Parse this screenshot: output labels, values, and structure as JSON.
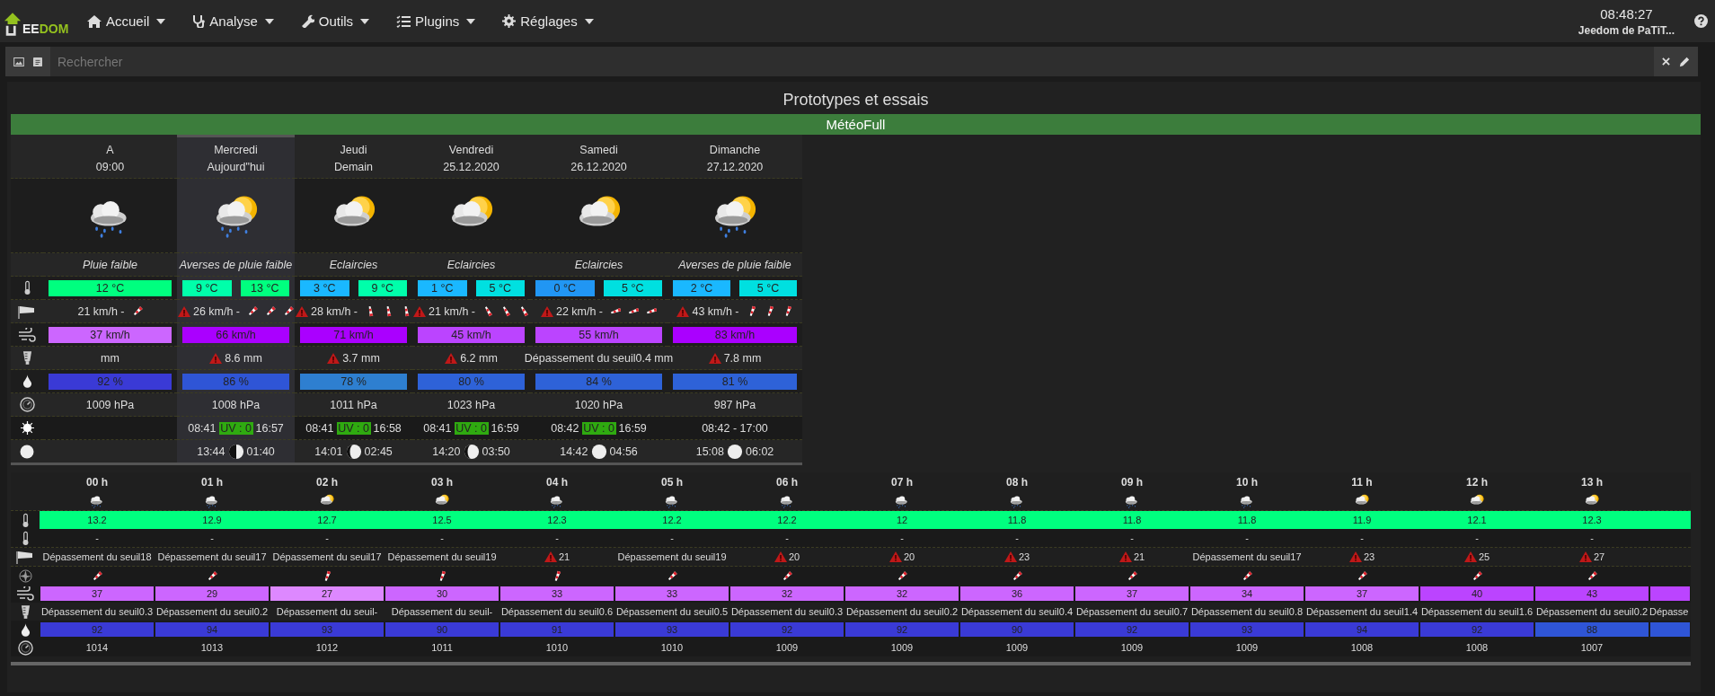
{
  "navbar": {
    "logo": {
      "text_light": "EE",
      "text_accent": "DOM"
    },
    "menu": [
      {
        "label": "Accueil"
      },
      {
        "label": "Analyse"
      },
      {
        "label": "Outils"
      },
      {
        "label": "Plugins"
      },
      {
        "label": "Réglages"
      }
    ],
    "time": "08:48:27",
    "user": "Jeedom de PaTiT..."
  },
  "search": {
    "placeholder": "Rechercher"
  },
  "view": {
    "title": "Prototypes et essais",
    "widget_title": "MétéoFull"
  },
  "daily": {
    "columns": [
      {
        "day": "A",
        "date": "09:00",
        "selected": false,
        "weather": {
          "kind": "rain"
        },
        "condition": "Pluie faible",
        "temps": [
          {
            "text": "12 °C",
            "color": "#00ff7f"
          }
        ],
        "wind": {
          "alert": false,
          "text": "21 km/h -",
          "directions": [
            {
              "kind": "ne"
            }
          ]
        },
        "gust": {
          "text": "37 km/h",
          "color": "#cc66ff"
        },
        "rain": {
          "alert": false,
          "text": "mm"
        },
        "humidity": {
          "text": "92 %",
          "color": "#3a3ad6"
        },
        "pressure": "1009 hPa",
        "sun": {
          "kind": "none"
        },
        "moon": {
          "kind": "none"
        }
      },
      {
        "day": "Mercredi",
        "date": "Aujourd\"hui",
        "selected": true,
        "weather": {
          "kind": "showers"
        },
        "condition": "Averses de pluie faible",
        "temps": [
          {
            "text": "9 °C",
            "color": "#00ffaa"
          },
          {
            "text": "13 °C",
            "color": "#00ff7f"
          }
        ],
        "wind": {
          "alert": true,
          "text": "26 km/h -",
          "directions": [
            {
              "kind": "ne"
            },
            {
              "kind": "ne"
            },
            {
              "kind": "ne"
            }
          ]
        },
        "gust": {
          "text": "66 km/h",
          "color": "#aa00ff"
        },
        "rain": {
          "alert": true,
          "text": "8.6 mm"
        },
        "humidity": {
          "text": "86 %",
          "color": "#2f55d6"
        },
        "pressure": "1008 hPa",
        "sun": {
          "kind": "uv",
          "rise": "08:41",
          "uv": "UV : 0",
          "set": "16:57"
        },
        "moon": {
          "kind": "times",
          "rise": "13:44",
          "icon": {
            "kind": "half"
          },
          "set": "01:40"
        }
      },
      {
        "day": "Jeudi",
        "date": "Demain",
        "selected": false,
        "weather": {
          "kind": "partly"
        },
        "condition": "Eclaircies",
        "temps": [
          {
            "text": "3 °C",
            "color": "#1ab8ff"
          },
          {
            "text": "9 °C",
            "color": "#00ffaa"
          }
        ],
        "wind": {
          "alert": true,
          "text": "28 km/h -",
          "directions": [
            {
              "kind": "s"
            },
            {
              "kind": "s"
            },
            {
              "kind": "s"
            }
          ]
        },
        "gust": {
          "text": "71 km/h",
          "color": "#aa00ff"
        },
        "rain": {
          "alert": true,
          "text": "3.7 mm"
        },
        "humidity": {
          "text": "78 %",
          "color": "#2e7fd0"
        },
        "pressure": "1011 hPa",
        "sun": {
          "kind": "uv",
          "rise": "08:41",
          "uv": "UV : 0",
          "set": "16:58"
        },
        "moon": {
          "kind": "times",
          "rise": "14:01",
          "icon": {
            "kind": "gibbous"
          },
          "set": "02:45"
        }
      },
      {
        "day": "Vendredi",
        "date": "25.12.2020",
        "selected": false,
        "weather": {
          "kind": "partly"
        },
        "condition": "Eclaircies",
        "temps": [
          {
            "text": "1 °C",
            "color": "#1ab8ff"
          },
          {
            "text": "5 °C",
            "color": "#00e0e0"
          }
        ],
        "wind": {
          "alert": true,
          "text": "21 km/h -",
          "directions": [
            {
              "kind": "sse"
            },
            {
              "kind": "sse"
            },
            {
              "kind": "sse"
            }
          ]
        },
        "gust": {
          "text": "45 km/h",
          "color": "#bb44ff"
        },
        "rain": {
          "alert": true,
          "text": "6.2 mm"
        },
        "humidity": {
          "text": "80 %",
          "color": "#2e62d8"
        },
        "pressure": "1023 hPa",
        "sun": {
          "kind": "uv",
          "rise": "08:41",
          "uv": "UV : 0",
          "set": "16:59"
        },
        "moon": {
          "kind": "times",
          "rise": "14:20",
          "icon": {
            "kind": "gibbous"
          },
          "set": "03:50"
        }
      },
      {
        "day": "Samedi",
        "date": "26.12.2020",
        "selected": false,
        "weather": {
          "kind": "partly"
        },
        "condition": "Eclaircies",
        "temps": [
          {
            "text": "0 °C",
            "color": "#2196f3"
          },
          {
            "text": "5 °C",
            "color": "#00e0e0"
          }
        ],
        "wind": {
          "alert": true,
          "text": "22 km/h -",
          "directions": [
            {
              "kind": "ene"
            },
            {
              "kind": "ene"
            },
            {
              "kind": "ene"
            }
          ]
        },
        "gust": {
          "text": "55 km/h",
          "color": "#bb44ff"
        },
        "rain": {
          "alert": false,
          "text": "Dépassement du seuil0.4 mm"
        },
        "humidity": {
          "text": "84 %",
          "color": "#2e62d8"
        },
        "pressure": "1020 hPa",
        "sun": {
          "kind": "uv",
          "rise": "08:42",
          "uv": "UV : 0",
          "set": "16:59"
        },
        "moon": {
          "kind": "times",
          "rise": "14:42",
          "icon": {
            "kind": "full"
          },
          "set": "04:56"
        }
      },
      {
        "day": "Dimanche",
        "date": "27.12.2020",
        "selected": false,
        "weather": {
          "kind": "showers"
        },
        "condition": "Averses de pluie faible",
        "temps": [
          {
            "text": "2 °C",
            "color": "#1ab8ff"
          },
          {
            "text": "5 °C",
            "color": "#00e0e0"
          }
        ],
        "wind": {
          "alert": true,
          "text": "43 km/h -",
          "directions": [
            {
              "kind": "nne"
            },
            {
              "kind": "nne"
            },
            {
              "kind": "nne"
            }
          ]
        },
        "gust": {
          "text": "83 km/h",
          "color": "#aa00ff"
        },
        "rain": {
          "alert": true,
          "text": "7.8 mm"
        },
        "humidity": {
          "text": "81 %",
          "color": "#2e62d8"
        },
        "pressure": "987 hPa",
        "sun": {
          "kind": "range",
          "text": "08:42 - 17:00"
        },
        "moon": {
          "kind": "times",
          "rise": "15:08",
          "icon": {
            "kind": "full"
          },
          "set": "06:02"
        }
      }
    ]
  },
  "hourly": {
    "hours": [
      {
        "time": "00 h",
        "weather": {
          "kind": "rain"
        },
        "temp": {
          "text": "13.2",
          "color": "#00ff7f"
        },
        "temp2": "-",
        "wind": {
          "alert": false,
          "text": "Dépassement du seuil18"
        },
        "direction": {
          "kind": "ne"
        },
        "gust": {
          "text": "37",
          "color": "#cc66ff"
        },
        "rain": "Dépassement du seuil0.3",
        "humidity": {
          "text": "92",
          "color": "#3a3ad6"
        },
        "pressure": "1014"
      },
      {
        "time": "01 h",
        "weather": {
          "kind": "rain"
        },
        "temp": {
          "text": "12.9",
          "color": "#00ff7f"
        },
        "temp2": "-",
        "wind": {
          "alert": false,
          "text": "Dépassement du seuil17"
        },
        "direction": {
          "kind": "ne"
        },
        "gust": {
          "text": "29",
          "color": "#cc66ff"
        },
        "rain": "Dépassement du seuil0.2",
        "humidity": {
          "text": "94",
          "color": "#3a3ad6"
        },
        "pressure": "1013"
      },
      {
        "time": "02 h",
        "weather": {
          "kind": "partly"
        },
        "temp": {
          "text": "12.7",
          "color": "#00ff7f"
        },
        "temp2": "-",
        "wind": {
          "alert": false,
          "text": "Dépassement du seuil17"
        },
        "direction": {
          "kind": "nne"
        },
        "gust": {
          "text": "27",
          "color": "#dd88ff"
        },
        "rain": "Dépassement du seuil-",
        "humidity": {
          "text": "93",
          "color": "#3a3ad6"
        },
        "pressure": "1012"
      },
      {
        "time": "03 h",
        "weather": {
          "kind": "partly"
        },
        "temp": {
          "text": "12.5",
          "color": "#00ff7f"
        },
        "temp2": "-",
        "wind": {
          "alert": false,
          "text": "Dépassement du seuil19"
        },
        "direction": {
          "kind": "nne"
        },
        "gust": {
          "text": "30",
          "color": "#cc66ff"
        },
        "rain": "Dépassement du seuil-",
        "humidity": {
          "text": "90",
          "color": "#3a3ad6"
        },
        "pressure": "1011"
      },
      {
        "time": "04 h",
        "weather": {
          "kind": "rain"
        },
        "temp": {
          "text": "12.3",
          "color": "#00ff7f"
        },
        "temp2": "-",
        "wind": {
          "alert": true,
          "text": "21"
        },
        "direction": {
          "kind": "nne"
        },
        "gust": {
          "text": "33",
          "color": "#cc66ff"
        },
        "rain": "Dépassement du seuil0.6",
        "humidity": {
          "text": "91",
          "color": "#3a3ad6"
        },
        "pressure": "1010"
      },
      {
        "time": "05 h",
        "weather": {
          "kind": "rain"
        },
        "temp": {
          "text": "12.2",
          "color": "#00ff7f"
        },
        "temp2": "-",
        "wind": {
          "alert": false,
          "text": "Dépassement du seuil19"
        },
        "direction": {
          "kind": "ne"
        },
        "gust": {
          "text": "33",
          "color": "#cc66ff"
        },
        "rain": "Dépassement du seuil0.5",
        "humidity": {
          "text": "93",
          "color": "#3a3ad6"
        },
        "pressure": "1010"
      },
      {
        "time": "06 h",
        "weather": {
          "kind": "rain"
        },
        "temp": {
          "text": "12.2",
          "color": "#00ff7f"
        },
        "temp2": "-",
        "wind": {
          "alert": true,
          "text": "20"
        },
        "direction": {
          "kind": "ne"
        },
        "gust": {
          "text": "32",
          "color": "#cc66ff"
        },
        "rain": "Dépassement du seuil0.3",
        "humidity": {
          "text": "92",
          "color": "#3a3ad6"
        },
        "pressure": "1009"
      },
      {
        "time": "07 h",
        "weather": {
          "kind": "rain"
        },
        "temp": {
          "text": "12",
          "color": "#00ff7f"
        },
        "temp2": "-",
        "wind": {
          "alert": true,
          "text": "20"
        },
        "direction": {
          "kind": "ne"
        },
        "gust": {
          "text": "32",
          "color": "#cc66ff"
        },
        "rain": "Dépassement du seuil0.2",
        "humidity": {
          "text": "92",
          "color": "#3a3ad6"
        },
        "pressure": "1009"
      },
      {
        "time": "08 h",
        "weather": {
          "kind": "rain"
        },
        "temp": {
          "text": "11.8",
          "color": "#00ff7f"
        },
        "temp2": "-",
        "wind": {
          "alert": true,
          "text": "23"
        },
        "direction": {
          "kind": "ne"
        },
        "gust": {
          "text": "36",
          "color": "#cc66ff"
        },
        "rain": "Dépassement du seuil0.4",
        "humidity": {
          "text": "90",
          "color": "#3a3ad6"
        },
        "pressure": "1009"
      },
      {
        "time": "09 h",
        "weather": {
          "kind": "rain"
        },
        "temp": {
          "text": "11.8",
          "color": "#00ff7f"
        },
        "temp2": "-",
        "wind": {
          "alert": true,
          "text": "21"
        },
        "direction": {
          "kind": "ne"
        },
        "gust": {
          "text": "37",
          "color": "#cc66ff"
        },
        "rain": "Dépassement du seuil0.7",
        "humidity": {
          "text": "92",
          "color": "#3a3ad6"
        },
        "pressure": "1009"
      },
      {
        "time": "10 h",
        "weather": {
          "kind": "rain"
        },
        "temp": {
          "text": "11.8",
          "color": "#00ff7f"
        },
        "temp2": "-",
        "wind": {
          "alert": false,
          "text": "Dépassement du seuil17"
        },
        "direction": {
          "kind": "ne"
        },
        "gust": {
          "text": "34",
          "color": "#cc66ff"
        },
        "rain": "Dépassement du seuil0.8",
        "humidity": {
          "text": "93",
          "color": "#3a3ad6"
        },
        "pressure": "1009"
      },
      {
        "time": "11 h",
        "weather": {
          "kind": "partly"
        },
        "temp": {
          "text": "11.9",
          "color": "#00ff7f"
        },
        "temp2": "-",
        "wind": {
          "alert": true,
          "text": "23"
        },
        "direction": {
          "kind": "ne"
        },
        "gust": {
          "text": "37",
          "color": "#cc66ff"
        },
        "rain": "Dépassement du seuil1.4",
        "humidity": {
          "text": "94",
          "color": "#3a3ad6"
        },
        "pressure": "1008"
      },
      {
        "time": "12 h",
        "weather": {
          "kind": "partly"
        },
        "temp": {
          "text": "12.1",
          "color": "#00ff7f"
        },
        "temp2": "-",
        "wind": {
          "alert": true,
          "text": "25"
        },
        "direction": {
          "kind": "ne"
        },
        "gust": {
          "text": "40",
          "color": "#bb44ff"
        },
        "rain": "Dépassement du seuil1.6",
        "humidity": {
          "text": "92",
          "color": "#3a3ad6"
        },
        "pressure": "1008"
      },
      {
        "time": "13 h",
        "weather": {
          "kind": "partly"
        },
        "temp": {
          "text": "12.3",
          "color": "#00ff7f"
        },
        "temp2": "-",
        "wind": {
          "alert": true,
          "text": "27"
        },
        "direction": {
          "kind": "ne"
        },
        "gust": {
          "text": "43",
          "color": "#bb44ff"
        },
        "rain": "Dépassement du seuil0.2",
        "humidity": {
          "text": "88",
          "color": "#2f55d6"
        },
        "pressure": "1007"
      }
    ],
    "partial_column": {
      "temp": {
        "color": "#00ff7f"
      },
      "gust": {
        "color": "#bb44ff"
      },
      "rain": "Dépasse",
      "humidity": {
        "color": "#2f55d6"
      }
    }
  }
}
